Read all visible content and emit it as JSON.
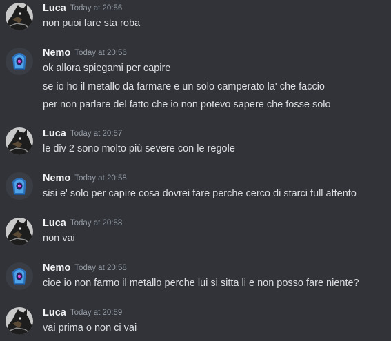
{
  "messages": [
    {
      "author": "Luca",
      "timestamp": "Today at 20:56",
      "avatar_icon": "dark-character-avatar",
      "lines": [
        "non puoi fare sta roba"
      ]
    },
    {
      "author": "Nemo",
      "timestamp": "Today at 20:56",
      "avatar_icon": "blue-eye-creature-avatar",
      "lines": [
        "ok allora spiegami per capire",
        "se io ho il metallo da farmare e un solo camperato la' che faccio",
        "per non parlare del fatto che io non potevo sapere che fosse solo"
      ]
    },
    {
      "author": "Luca",
      "timestamp": "Today at 20:57",
      "avatar_icon": "dark-character-avatar",
      "lines": [
        "le div 2 sono molto più severe con le regole"
      ]
    },
    {
      "author": "Nemo",
      "timestamp": "Today at 20:58",
      "avatar_icon": "blue-eye-creature-avatar",
      "lines": [
        "sisi e' solo per capire cosa dovrei fare perche cerco di starci full attento"
      ]
    },
    {
      "author": "Luca",
      "timestamp": "Today at 20:58",
      "avatar_icon": "dark-character-avatar",
      "lines": [
        "non vai"
      ]
    },
    {
      "author": "Nemo",
      "timestamp": "Today at 20:58",
      "avatar_icon": "blue-eye-creature-avatar",
      "lines": [
        "cioe io non farmo il metallo perche lui si sitta li e non posso fare niente?"
      ]
    },
    {
      "author": "Luca",
      "timestamp": "Today at 20:59",
      "avatar_icon": "dark-character-avatar",
      "lines": [
        "vai prima o non ci vai"
      ]
    }
  ],
  "colors": {
    "background": "#313338",
    "author": "#f2f3f5",
    "timestamp": "#949ba4",
    "text": "#dbdee1"
  }
}
